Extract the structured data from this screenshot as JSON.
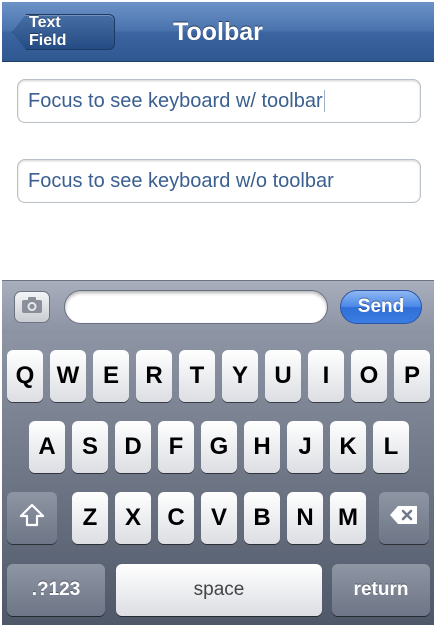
{
  "navbar": {
    "back_label": "Text Field",
    "title": "Toolbar"
  },
  "fields": [
    {
      "text": "Focus to see keyboard w/ toolbar"
    },
    {
      "text": "Focus to see keyboard w/o toolbar"
    }
  ],
  "toolbar": {
    "camera_icon": "camera-icon",
    "input_value": "",
    "send_label": "Send"
  },
  "keyboard": {
    "row1": [
      "Q",
      "W",
      "E",
      "R",
      "T",
      "Y",
      "U",
      "I",
      "O",
      "P"
    ],
    "row2": [
      "A",
      "S",
      "D",
      "F",
      "G",
      "H",
      "J",
      "K",
      "L"
    ],
    "row3": [
      "Z",
      "X",
      "C",
      "V",
      "B",
      "N",
      "M"
    ],
    "shift_icon": "shift-icon",
    "delete_icon": "delete-icon",
    "numbers_label": ".?123",
    "space_label": "space",
    "return_label": "return"
  }
}
